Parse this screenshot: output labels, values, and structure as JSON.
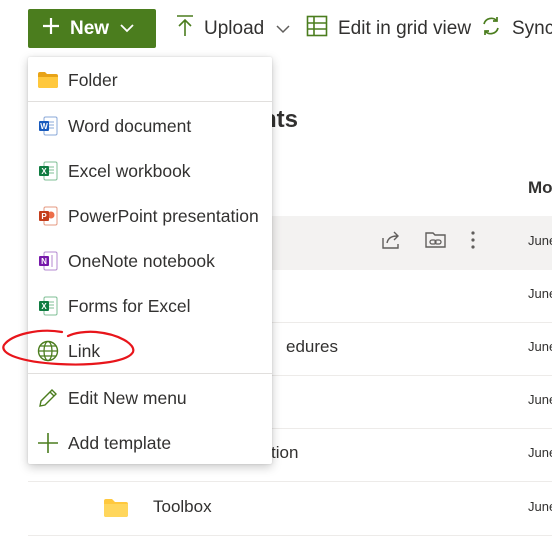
{
  "toolbar": {
    "new_label": "New",
    "upload_label": "Upload",
    "grid_label": "Edit in grid view",
    "sync_label": "Sync"
  },
  "page": {
    "title_fragment": "nts",
    "column_header": "Mo"
  },
  "rows": [
    {
      "name": "",
      "date": "June",
      "highlighted": true
    },
    {
      "name": "",
      "date": "June"
    },
    {
      "name": "edures",
      "date": "June"
    },
    {
      "name": "",
      "date": "June"
    },
    {
      "name": "tion",
      "date": "June"
    },
    {
      "name": "Toolbox",
      "date": "June"
    }
  ],
  "menu": {
    "items": [
      {
        "label": "Folder",
        "icon": "folder-icon"
      },
      {
        "label": "Word document",
        "icon": "word-icon"
      },
      {
        "label": "Excel workbook",
        "icon": "excel-icon"
      },
      {
        "label": "PowerPoint presentation",
        "icon": "powerpoint-icon"
      },
      {
        "label": "OneNote notebook",
        "icon": "onenote-icon"
      },
      {
        "label": "Forms for Excel",
        "icon": "forms-excel-icon"
      },
      {
        "label": "Link",
        "icon": "globe-icon"
      },
      {
        "label": "Edit New menu",
        "icon": "pencil-icon"
      },
      {
        "label": "Add template",
        "icon": "plus-icon"
      }
    ]
  },
  "colors": {
    "new_button": "#4b7d1e",
    "word": "#185abd",
    "excel": "#107c41",
    "powerpoint": "#c43e1c",
    "onenote": "#7719aa",
    "folder": "#ffc83d",
    "annotation": "#e8151b"
  }
}
